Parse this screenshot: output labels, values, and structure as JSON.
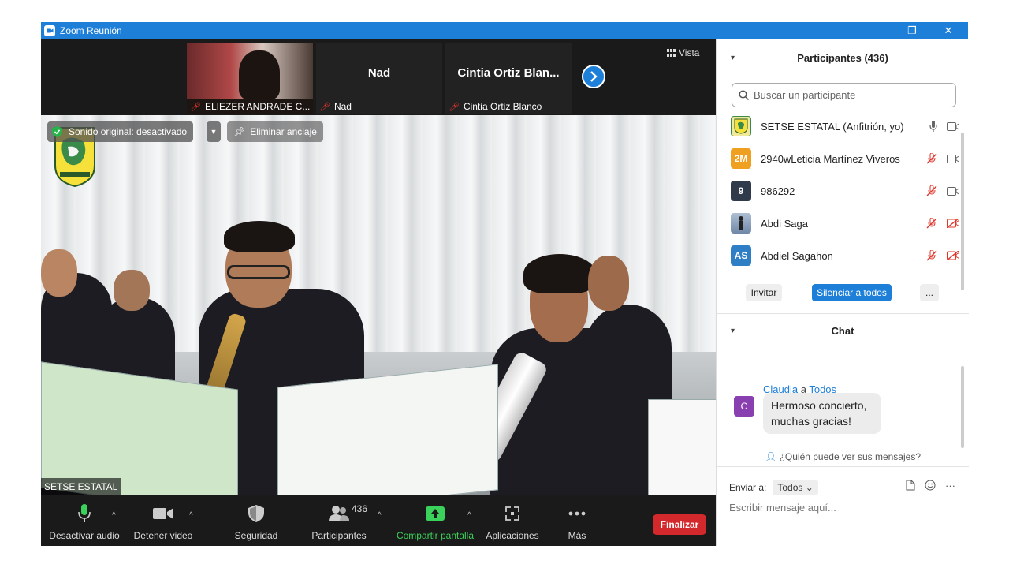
{
  "window": {
    "title": "Zoom Reunión",
    "minimize": "–",
    "restore": "❐",
    "close": "✕"
  },
  "thumbnails": [
    {
      "name": "ELIEZER ANDRADE C...",
      "video": true
    },
    {
      "name": "Nad",
      "center": "Nad"
    },
    {
      "name": "Cintia Ortiz Blanco",
      "center": "Cintia  Ortiz  Blan..."
    }
  ],
  "vista": "Vista",
  "main": {
    "sound_badge": "Sonido original: desactivado",
    "unpin": "Eliminar anclaje",
    "speaker": "SETSE ESTATAL"
  },
  "toolbar": {
    "audio": "Desactivar audio",
    "video": "Detener video",
    "security": "Seguridad",
    "participants": "Participantes",
    "participants_count": "436",
    "share": "Compartir pantalla",
    "apps": "Aplicaciones",
    "more": "Más",
    "end": "Finalizar"
  },
  "participants_panel": {
    "title": "Participantes (436)",
    "search_placeholder": "Buscar un participante",
    "list": [
      {
        "initials": "",
        "color": "#e8e4a0",
        "name": "SETSE ESTATAL (Anfitrión, yo)"
      },
      {
        "initials": "2M",
        "color": "#f0a020",
        "name": "2940wLeticia Martínez Viveros"
      },
      {
        "initials": "9",
        "color": "#2f3a4a",
        "name": "986292"
      },
      {
        "initials": "",
        "color": "#6f88a8",
        "name": "Abdi Saga"
      },
      {
        "initials": "AS",
        "color": "#2f7fc7",
        "name": "Abdiel Sagahon"
      }
    ],
    "invite": "Invitar",
    "mute_all": "Silenciar a todos",
    "more": "..."
  },
  "chat": {
    "title": "Chat",
    "sender": "Claudia",
    "a": "a",
    "recipient": "Todos",
    "avatar": "C",
    "message": "Hermoso concierto, muchas gracias!",
    "who_sees": "¿Quién puede ver sus mensajes?",
    "send_to_label": "Enviar a:",
    "send_to_value": "Todos",
    "input_placeholder": "Escribir mensaje aquí...",
    "more": "···"
  }
}
